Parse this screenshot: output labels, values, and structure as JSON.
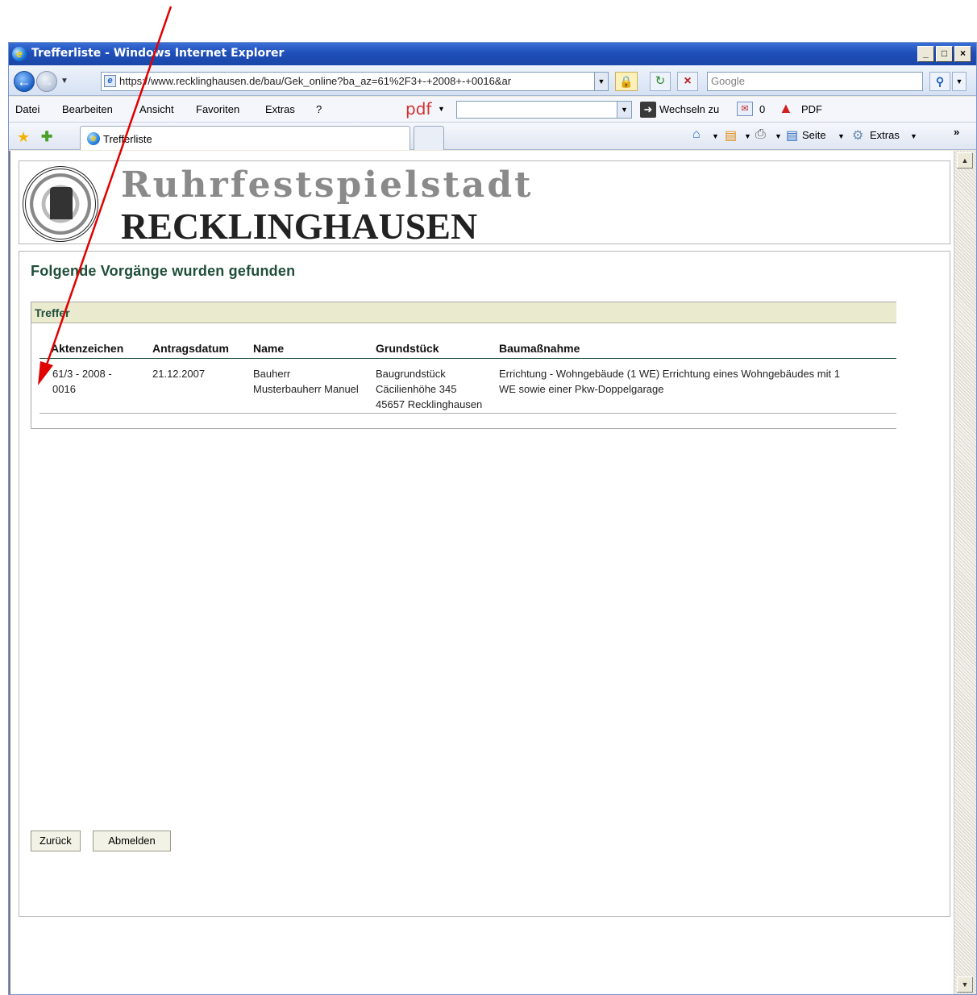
{
  "window": {
    "title": "Trefferliste - Windows Internet Explorer",
    "controls": {
      "minimize": "_",
      "maximize": "□",
      "close": "×"
    }
  },
  "addressbar": {
    "url": "https://www.recklinghausen.de/bau/Gek_online?ba_az=61%2F3+-+2008+-+0016&ar",
    "search_placeholder": "Google"
  },
  "menu": {
    "items": [
      "Datei",
      "Bearbeiten",
      "Ansicht",
      "Favoriten",
      "Extras",
      "?"
    ],
    "pdf_logo": "pdf",
    "wechseln_label": "Wechseln zu",
    "mail_count": "0",
    "pdf_label": "PDF"
  },
  "favbar": {
    "tab_label": "Trefferliste",
    "commands": {
      "seite": "Seite",
      "extras": "Extras"
    }
  },
  "logo": {
    "line1": "Ruhrfestspielstadt",
    "line2": "RECKLINGHAUSEN"
  },
  "page": {
    "heading": "Folgende Vorgänge wurden gefunden",
    "result_section": "Treffer",
    "columns": [
      "Aktenzeichen",
      "Antragsdatum",
      "Name",
      "Grundstück",
      "Baumaßnahme"
    ],
    "row": {
      "aktenzeichen_1": "61/3 - 2008 -",
      "aktenzeichen_2": "0016",
      "antragsdatum": "21.12.2007",
      "name_1": "Bauherr",
      "name_2": "Musterbauherr Manuel",
      "grundstueck_1": "Baugrundstück",
      "grundstueck_2": "Cäcilienhöhe 345",
      "grundstueck_3": "45657 Recklinghausen",
      "baumassnahme_1": "Errichtung - Wohngebäude (1 WE) Errichtung eines Wohngebäudes mit 1",
      "baumassnahme_2": "WE sowie einer Pkw-Doppelgarage"
    },
    "buttons": {
      "back": "Zurück",
      "logout": "Abmelden"
    }
  },
  "colors": {
    "annotation_arrow": "#e00000",
    "heading_green": "#1e4e3a",
    "header_band": "#eaeacf"
  }
}
